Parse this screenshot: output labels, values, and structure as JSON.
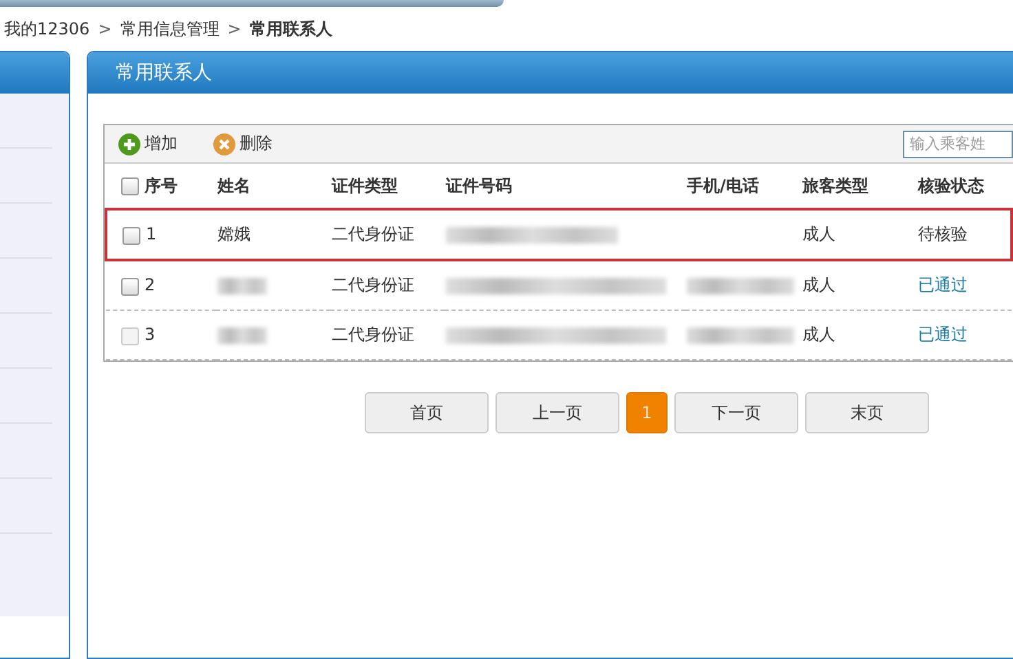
{
  "breadcrumb": [
    {
      "label": "我的12306",
      "current": false
    },
    {
      "label": "常用信息管理",
      "separator": ">",
      "current": false
    },
    {
      "label": "常用联系人",
      "separator": ">",
      "current": true
    }
  ],
  "panel": {
    "title": "常用联系人"
  },
  "toolbar": {
    "buttons": [
      {
        "label": "增加",
        "kind": "add"
      },
      {
        "label": "删除",
        "kind": "delete"
      }
    ],
    "search": {
      "placeholder": "输入乘客姓"
    }
  },
  "table": {
    "columns": [
      "序号",
      "姓名",
      "证件类型",
      "证件号码",
      "手机/电话",
      "旅客类型",
      "核验状态"
    ],
    "select_all": {
      "checked": false
    },
    "rows": [
      {
        "index": "1",
        "name": "嫦娥",
        "name_masked": false,
        "id_type": "二代身份证",
        "id_number_masked": true,
        "phone_masked": false,
        "passenger_type": "成人",
        "status": "待核验",
        "verified": false,
        "checked": false,
        "disabled": false,
        "highlighted": true
      },
      {
        "index": "2",
        "name_masked": true,
        "id_type": "二代身份证",
        "id_number_masked": true,
        "phone_masked": true,
        "passenger_type": "成人",
        "status": "已通过",
        "verified": true,
        "checked": false,
        "disabled": false,
        "highlighted": false
      },
      {
        "index": "3",
        "name_masked": true,
        "id_type": "二代身份证",
        "id_number_masked": true,
        "phone_masked": true,
        "passenger_type": "成人",
        "status": "已通过",
        "verified": true,
        "checked": false,
        "disabled": true,
        "highlighted": false
      }
    ]
  },
  "pagination": [
    {
      "label": "首页",
      "selected": false
    },
    {
      "label": "上一页",
      "selected": false
    },
    {
      "label": "1",
      "selected": true
    },
    {
      "label": "下一页",
      "selected": false
    },
    {
      "label": "末页",
      "selected": false
    }
  ]
}
